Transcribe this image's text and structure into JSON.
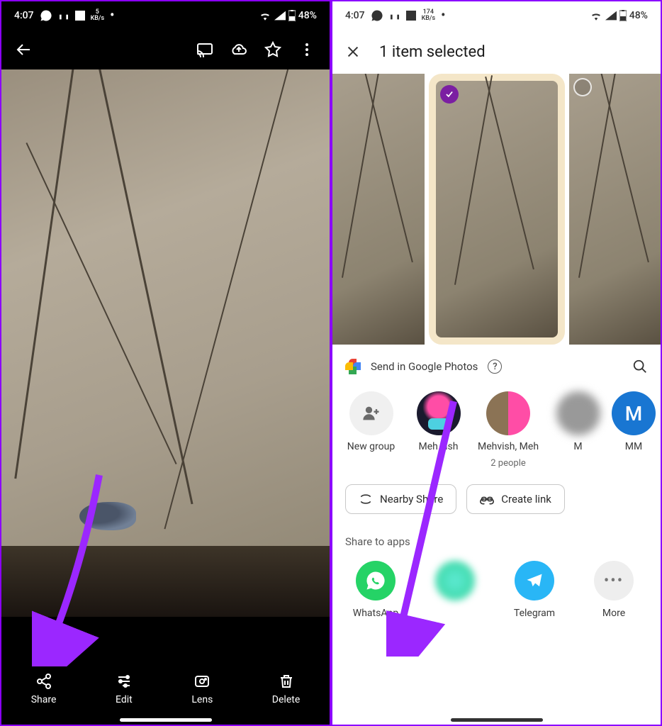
{
  "left": {
    "status": {
      "time": "4:07",
      "net_rate": "5",
      "net_unit": "KB/s",
      "battery": "48%"
    },
    "actions": {
      "share": "Share",
      "edit": "Edit",
      "lens": "Lens",
      "delete": "Delete"
    }
  },
  "right": {
    "status": {
      "time": "4:07",
      "net_rate": "174",
      "net_unit": "KB/s",
      "battery": "48%"
    },
    "header": {
      "title": "1 item selected"
    },
    "share": {
      "send_label": "Send in Google Photos",
      "contacts": [
        {
          "name": "New group",
          "sub": ""
        },
        {
          "name": "Meh vish",
          "sub": ""
        },
        {
          "name": "Mehvish, Meh",
          "sub": "2 people"
        },
        {
          "name": "M",
          "sub": ""
        },
        {
          "name": "MM",
          "sub": ""
        }
      ],
      "chips": {
        "nearby": "Nearby Share",
        "link": "Create link"
      },
      "apps_label": "Share to apps",
      "apps": {
        "whatsapp": "WhatsApp",
        "telegram": "Telegram",
        "more": "More"
      }
    }
  }
}
